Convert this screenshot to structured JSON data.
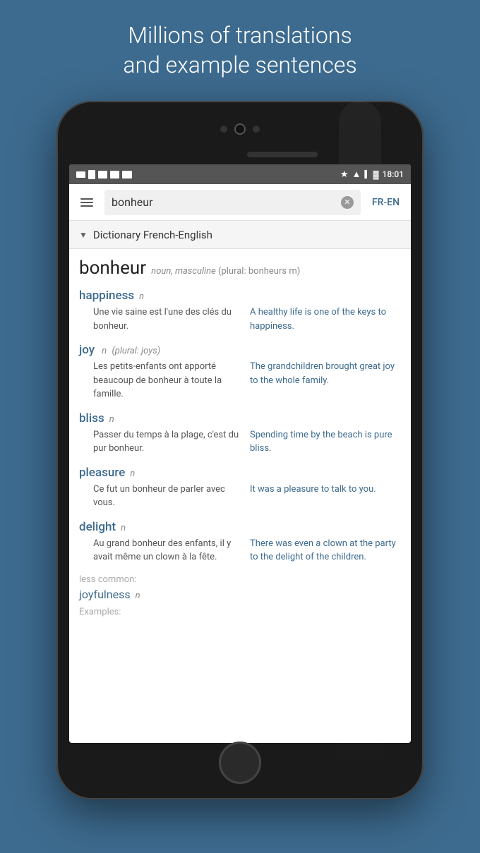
{
  "hero": {
    "line1": "Millions of translations",
    "line2": "and example sentences"
  },
  "status_bar": {
    "time": "18:01"
  },
  "search": {
    "query": "bonheur",
    "lang": "FR-EN",
    "clear_symbol": "✕"
  },
  "dictionary": {
    "header": "Dictionary French-English",
    "word": "bonheur",
    "pos": "noun, masculine",
    "plural_label": "plural:",
    "plural": "bonheurs",
    "plural_gender": "m",
    "entries": [
      {
        "id": "happiness",
        "word": "happiness",
        "pos": "n",
        "plural_info": "",
        "fr": "Une vie saine est l'une des clés du bonheur.",
        "en": "A healthy life is one of the keys to happiness."
      },
      {
        "id": "joy",
        "word": "joy",
        "pos": "n",
        "plural_info": "plural: joys",
        "fr": "Les petits-enfants ont apporté beaucoup de bonheur à toute la famille.",
        "en": "The grandchildren brought great joy to the whole family."
      },
      {
        "id": "bliss",
        "word": "bliss",
        "pos": "n",
        "plural_info": "",
        "fr": "Passer du temps à la plage, c'est du pur bonheur.",
        "en": "Spending time by the beach is pure bliss."
      },
      {
        "id": "pleasure",
        "word": "pleasure",
        "pos": "n",
        "plural_info": "",
        "fr": "Ce fut un bonheur de parler avec vous.",
        "en": "It was a pleasure to talk to you."
      },
      {
        "id": "delight",
        "word": "delight",
        "pos": "n",
        "plural_info": "",
        "fr": "Au grand bonheur des enfants, il y avait même un clown à la fête.",
        "en": "There was even a clown at the party to the delight of the children."
      }
    ],
    "less_common_label": "less common:",
    "less_common_word": "joyfulness",
    "less_common_pos": "n",
    "examples_label": "Examples:"
  }
}
